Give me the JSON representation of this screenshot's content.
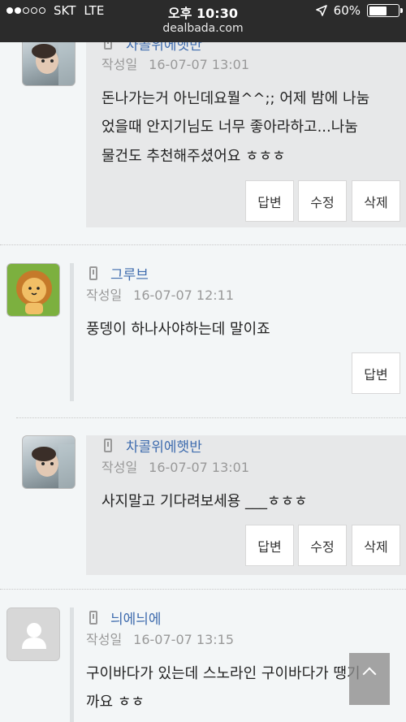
{
  "status_bar": {
    "carrier": "SKT",
    "network": "LTE",
    "time": "오후 10:30",
    "battery": "60%",
    "battery_level": 0.6,
    "signal_bars": 2,
    "url": "dealbada.com"
  },
  "comments": [
    {
      "author": "차콜위에햇반",
      "date_label": "작성일",
      "date": "16-07-07 13:01",
      "lines": [
        "돈나가는거 아닌데요뭘^^;; 어제 밤에 나눔",
        "었을때 안지기님도 너무 좋아라하고...나눔",
        "물건도 추천해주셨어요 ㅎㅎㅎ"
      ],
      "buttons": [
        "답변",
        "수정",
        "삭제"
      ]
    },
    {
      "author": "그루브",
      "date_label": "작성일",
      "date": "16-07-07 12:11",
      "lines": [
        "풍뎅이 하나사야하는데 말이죠"
      ],
      "buttons": [
        "답변"
      ]
    },
    {
      "author": "차콜위에햇반",
      "date_label": "작성일",
      "date": "16-07-07 13:01",
      "lines": [
        "사지말고 기다려보세용 ___ㅎㅎㅎ"
      ],
      "buttons": [
        "답변",
        "수정",
        "삭제"
      ]
    },
    {
      "author": "늬에늬에",
      "date_label": "작성일",
      "date": "16-07-07 13:15",
      "lines": [
        "구이바다가 있는데 스노라인 구이바다가 땡기",
        "까요 ㅎㅎ"
      ],
      "buttons": []
    }
  ],
  "colors": {
    "author": "#3f6cae",
    "meta": "#999999",
    "comment_box": "#e7e8e9",
    "page_bg": "#f3f6f7"
  },
  "icons": {
    "phone": "mobile-phone-icon",
    "scroll_top": "arrow-up-icon",
    "location": "location-arrow-icon"
  }
}
